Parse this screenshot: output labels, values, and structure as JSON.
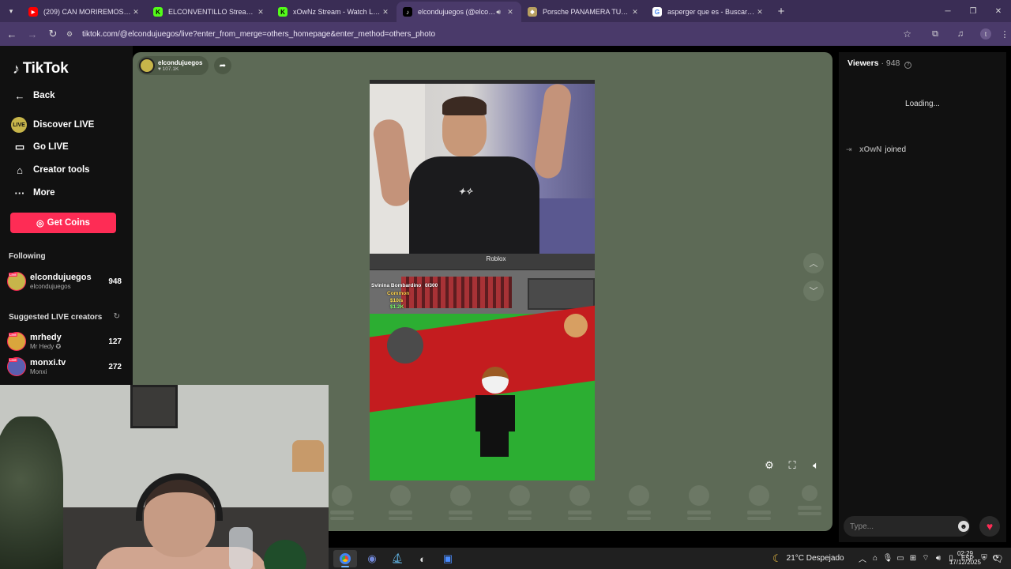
{
  "browser": {
    "tabs": [
      {
        "title": "(209) CAN MORIREMOS TIAN M",
        "favicon": "youtube-icon",
        "color": "#ff0000",
        "active": false
      },
      {
        "title": "ELCONVENTILLO Stream - Watc",
        "favicon": "kick-icon",
        "color": "#53fc18",
        "active": false
      },
      {
        "title": "xOwNz Stream - Watch Live on",
        "favicon": "kick-icon",
        "color": "#53fc18",
        "active": false
      },
      {
        "title": "elcondujuegos (@elcondu",
        "favicon": "tiktok-icon",
        "color": "#000000",
        "active": true
      },
      {
        "title": "Porsche PANAMERA TURBO V8",
        "favicon": "porsche-icon",
        "color": "#b8a060",
        "active": false
      },
      {
        "title": "asperger que es - Buscar con G",
        "favicon": "google-icon",
        "color": "#ffffff",
        "active": false
      }
    ],
    "url": "tiktok.com/@elcondujuegos/live?enter_from_merge=others_homepage&enter_method=others_photo"
  },
  "sidebar": {
    "logo": "TikTok",
    "items": [
      {
        "label": "Back",
        "icon": "arrow-left-icon"
      },
      {
        "label": "Discover LIVE",
        "icon": "live-icon"
      },
      {
        "label": "Go LIVE",
        "icon": "video-camera-icon"
      },
      {
        "label": "Creator tools",
        "icon": "home-icon"
      },
      {
        "label": "More",
        "icon": "more-dots-icon"
      }
    ],
    "get_coins": "Get Coins",
    "following_title": "Following",
    "following": [
      {
        "name": "elcondujuegos",
        "handle": "elcondujuegos",
        "count": "948",
        "color": "#c7b54a"
      }
    ],
    "suggested_title": "Suggested LIVE creators",
    "suggested": [
      {
        "name": "mrhedy",
        "handle": "Mr Hedy",
        "count": "127",
        "color": "#d9a63c"
      },
      {
        "name": "monxi.tv",
        "handle": "Monxi",
        "count": "272",
        "color": "#5a5fb0"
      }
    ]
  },
  "player": {
    "streamer_name": "elcondujuegos",
    "streamer_likes": "107.1K",
    "game_label": "Roblox",
    "game_texts": [
      "Svinina Bombardino",
      "0/300",
      "Common",
      "$10/s",
      "$1.2K"
    ]
  },
  "chat": {
    "viewers_label": "Viewers",
    "viewers_count": "948",
    "loading": "Loading...",
    "joined_user": "xOwN",
    "joined_text": "joined",
    "placeholder": "Type..."
  },
  "taskbar": {
    "weather": "21°C Despejado",
    "lang": "ESP",
    "time": "02:29",
    "date": "17/12/2025"
  }
}
